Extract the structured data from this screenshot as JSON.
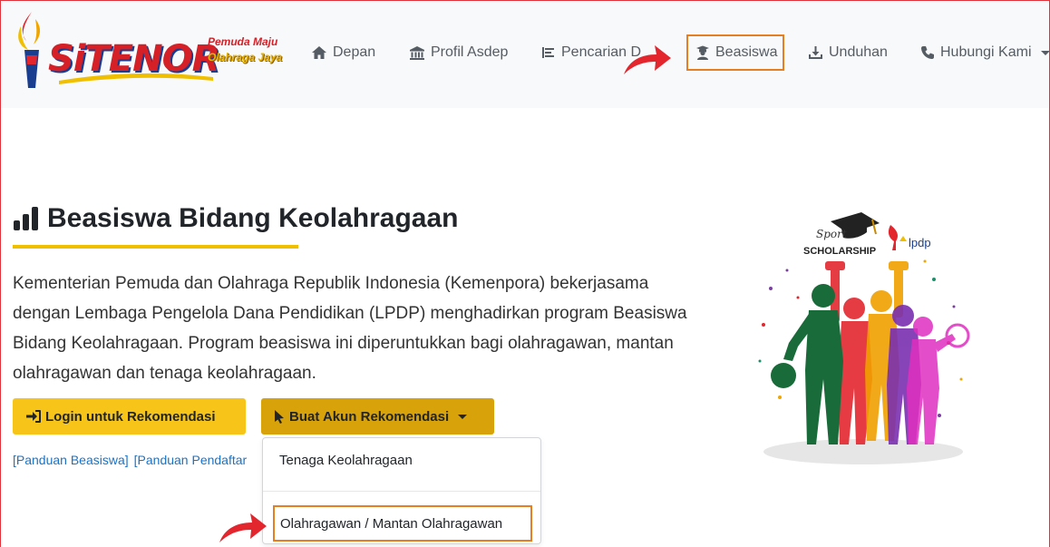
{
  "brand": {
    "name": "SiTENOR",
    "tagline_line1": "Pemuda Maju",
    "tagline_line2": "Olahraga Jaya"
  },
  "nav": {
    "items": [
      {
        "label": "Depan",
        "icon": "home-icon"
      },
      {
        "label": "Profil Asdep",
        "icon": "bank-icon"
      },
      {
        "label": "Pencarian D",
        "icon": "list-icon"
      },
      {
        "label": "Beasiswa",
        "icon": "graduate-icon"
      },
      {
        "label": "Unduhan",
        "icon": "download-icon"
      },
      {
        "label": "Hubungi Kami",
        "icon": "phone-icon"
      }
    ],
    "active_index": 3
  },
  "main": {
    "title": "Beasiswa Bidang Keolahragaan",
    "description": "Kementerian Pemuda dan Olahraga Republik Indonesia (Kemenpora) bekerjasama dengan Lembaga Pengelola Dana Pendidikan (LPDP) menghadirkan program Beasiswa Bidang Keolahragaan. Program beasiswa ini diperuntukkan bagi olahragawan, mantan olahragawan dan tenaga keolahragaan.",
    "login_button": "Login untuk Rekomendasi",
    "create_button": "Buat Akun Rekomendasi",
    "link_panduan_beasiswa": "[Panduan Beasiswa]",
    "link_panduan_pendaftar": "[Panduan Pendaftar"
  },
  "dropdown": {
    "items": [
      "Tenaga Keolahragaan",
      "Olahragawan / Mantan Olahragawan"
    ],
    "highlighted_index": 1
  },
  "illustration": {
    "sport_text": "Sport",
    "scholarship_text": "SCHOLARSHIP",
    "lpdp_text": "lpdp"
  },
  "colors": {
    "accent_yellow": "#f7c51a",
    "accent_gold": "#d8a20b",
    "highlight_orange": "#e67e22",
    "arrow_red": "#e3262e",
    "link_blue": "#1a73c7"
  }
}
